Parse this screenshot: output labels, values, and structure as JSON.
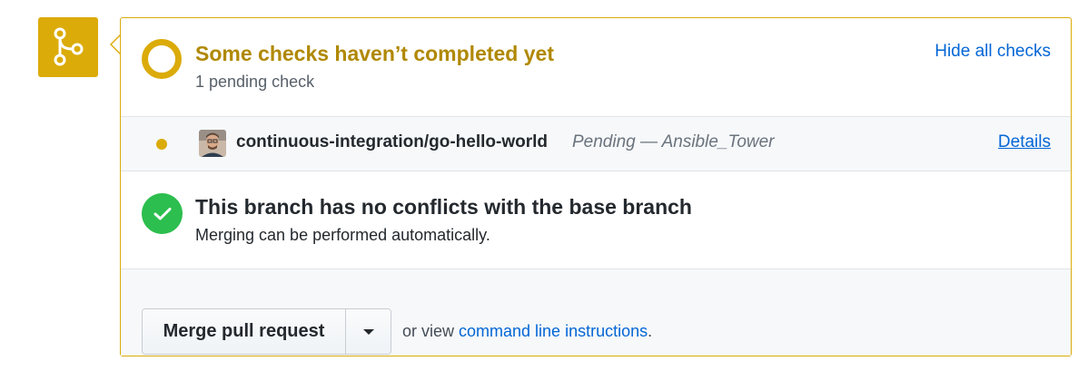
{
  "colors": {
    "pending": "#dbab09",
    "pending_text": "#b08800",
    "success": "#2cbe4e",
    "link": "#0366d6"
  },
  "merge_icon": {
    "icon": "git-merge-icon"
  },
  "checks": {
    "title": "Some checks haven’t completed yet",
    "subtitle": "1 pending check",
    "toggle_label": "Hide all checks",
    "status_icon": "pending-ring-icon"
  },
  "pending_check": {
    "context": "continuous-integration/go-hello-world",
    "description": "Pending — Ansible_Tower",
    "details_label": "Details",
    "status_icon": "pending-dot-icon"
  },
  "conflicts": {
    "title": "This branch has no conflicts with the base branch",
    "subtitle": "Merging can be performed automatically.",
    "status_icon": "check-icon"
  },
  "merge": {
    "button_label": "Merge pull request",
    "dropdown_icon": "caret-down-icon",
    "text_before": "or view ",
    "link_label": "command line instructions",
    "text_after": "."
  }
}
